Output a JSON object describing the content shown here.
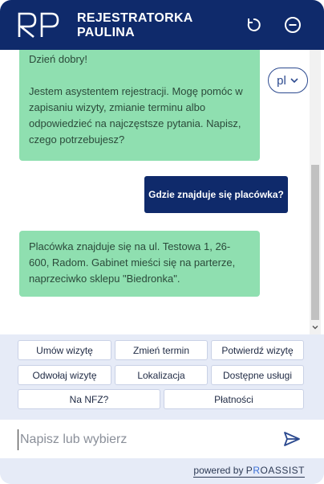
{
  "header": {
    "logo_text": "RP",
    "title_line1": "REJESTRATORKA",
    "title_line2": "PAULINA",
    "reload_icon": "reload-icon",
    "close_icon": "minus-circle-icon"
  },
  "language": {
    "selected": "pl"
  },
  "messages": [
    {
      "role": "bot",
      "line1": "Dzień dobry!",
      "line2": "Jestem asystentem rejestracji. Mogę pomóc w zapisaniu wizyty, zmianie terminu albo odpowiedzieć na najczęstsze pytania. Napisz, czego potrzebujesz?"
    },
    {
      "role": "user",
      "text": "Gdzie znajduje się placówka?"
    },
    {
      "role": "bot",
      "text": "Placówka znajduje się na ul. Testowa 1, 26-600, Radom. Gabinet mieści się na parterze, naprzeciwko sklepu \"Biedronka\"."
    }
  ],
  "quick_replies": [
    "Umów wizytę",
    "Zmień termin",
    "Potwierdź wizytę",
    "Odwołaj wizytę",
    "Lokalizacja",
    "Dostępne usługi",
    "Na NFZ?",
    "Płatności"
  ],
  "input": {
    "placeholder": "Napisz lub wybierz",
    "value": ""
  },
  "footer": {
    "powered": "powered by ",
    "brand_a": "P",
    "brand_r": "R",
    "brand_b": "OASSIST"
  },
  "colors": {
    "header": "#0f2a6b",
    "bot_bubble": "#8fdfb0",
    "user_bubble": "#0f2a6b",
    "panel": "#e6ebf7"
  }
}
